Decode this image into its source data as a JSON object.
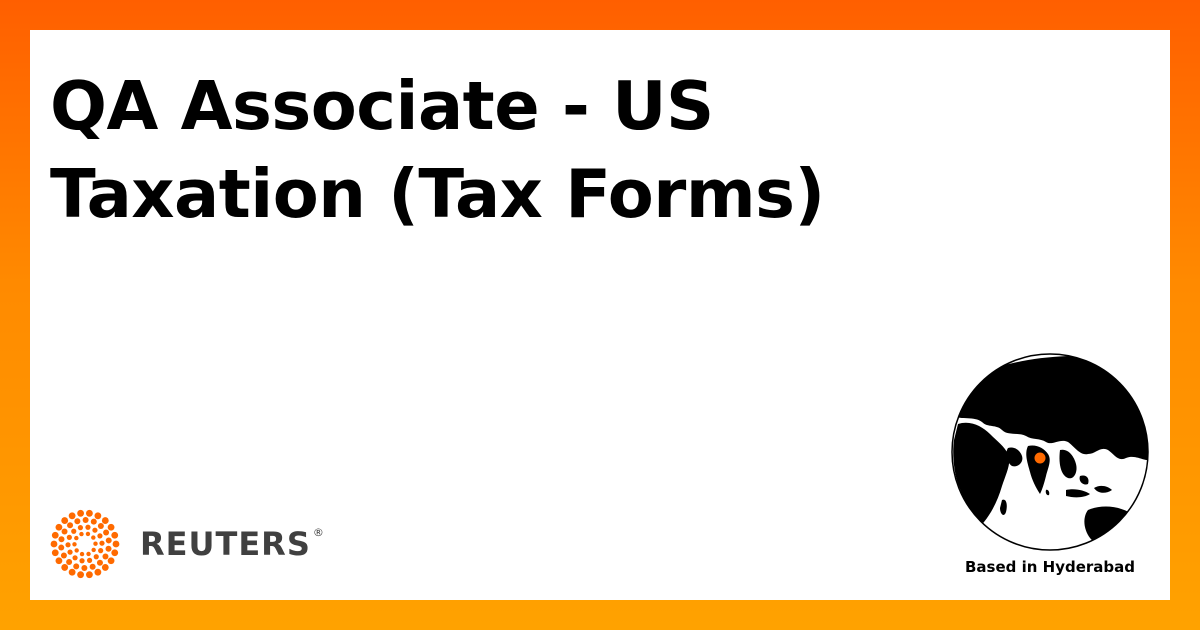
{
  "job": {
    "title": "QA Associate - US Taxation (Tax Forms)"
  },
  "brand": {
    "name": "REUTERS",
    "registered_mark": "®",
    "logo_icon": "reuters-dot-ring-icon",
    "accent_color": "#ff6a00"
  },
  "location": {
    "label": "Based in Hyderabad",
    "globe_icon": "globe-icon",
    "marker_color": "#ff6a00"
  },
  "theme": {
    "border_gradient_top": "#ff5f00",
    "border_gradient_bottom": "#ffa200",
    "card_background": "#ffffff",
    "text_color": "#000000",
    "logo_text_color": "#404040"
  }
}
